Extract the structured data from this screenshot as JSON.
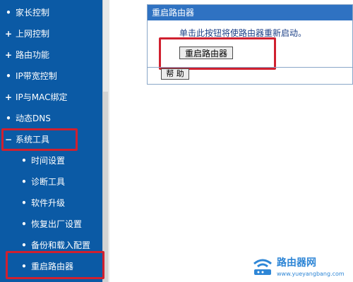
{
  "sidebar": {
    "items": [
      {
        "label": "家长控制",
        "bullet": "•"
      },
      {
        "label": "上网控制",
        "bullet": "+"
      },
      {
        "label": "路由功能",
        "bullet": "+"
      },
      {
        "label": "IP带宽控制",
        "bullet": "•"
      },
      {
        "label": "IP与MAC绑定",
        "bullet": "+"
      },
      {
        "label": "动态DNS",
        "bullet": "•"
      },
      {
        "label": "系统工具",
        "bullet": "−"
      }
    ],
    "sub_items": [
      {
        "label": "时间设置",
        "bullet": "•"
      },
      {
        "label": "诊断工具",
        "bullet": "•"
      },
      {
        "label": "软件升级",
        "bullet": "•"
      },
      {
        "label": "恢复出厂设置",
        "bullet": "•"
      },
      {
        "label": "备份和载入配置",
        "bullet": "•"
      },
      {
        "label": "重启路由器",
        "bullet": "•"
      }
    ]
  },
  "panel": {
    "title": "重启路由器",
    "description": "单击此按钮将使路由器重新启动。",
    "reboot_button": "重启路由器",
    "help_button": "帮 助"
  },
  "watermark": {
    "text": "路由器网",
    "url": "www.yueyangbang.com"
  },
  "colors": {
    "sidebar_bg": "#0b5aa5",
    "highlight": "#d0202f",
    "title_bar": "#2f72c2"
  }
}
